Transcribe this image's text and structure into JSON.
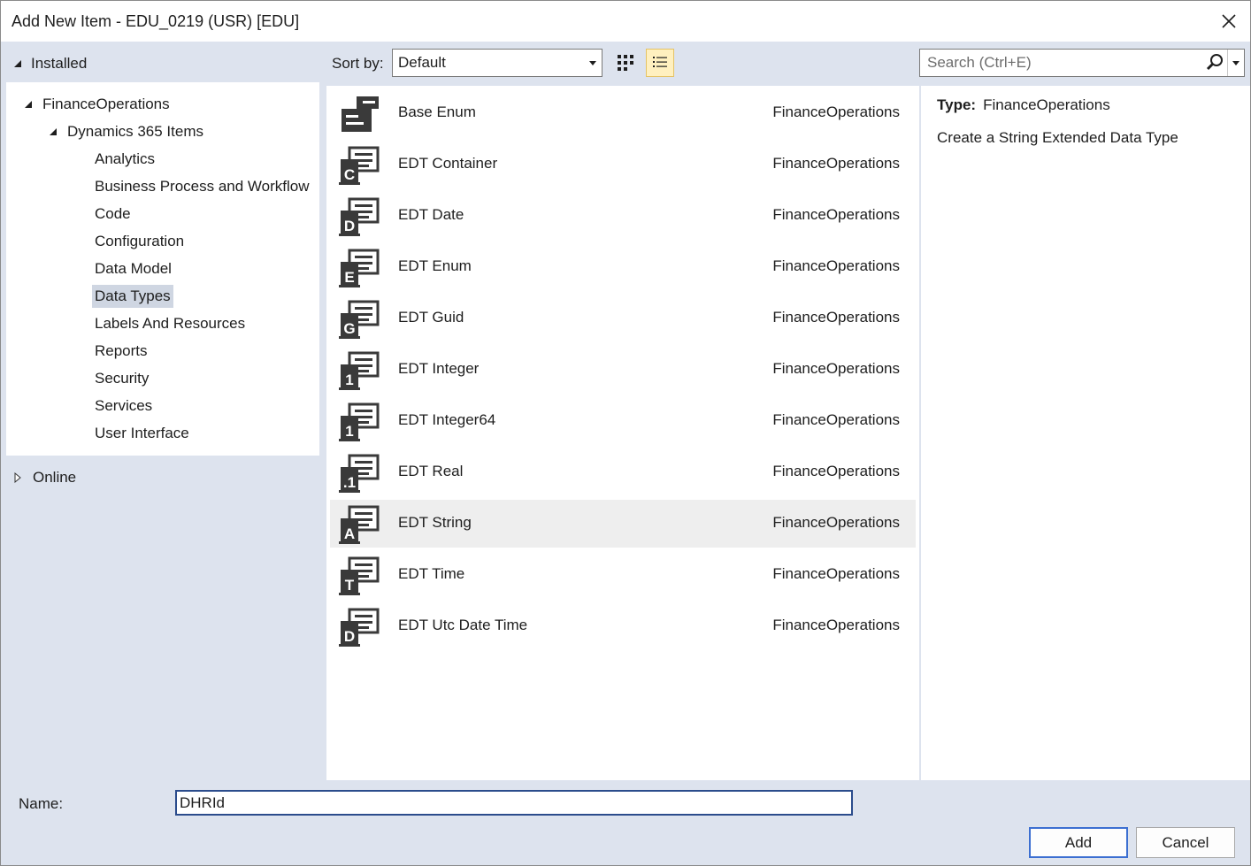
{
  "window": {
    "title": "Add New Item - EDU_0219 (USR) [EDU]"
  },
  "tree": {
    "installed_label": "Installed",
    "root_label": "FinanceOperations",
    "group_label": "Dynamics 365 Items",
    "items": [
      {
        "label": "Analytics"
      },
      {
        "label": "Business Process and Workflow"
      },
      {
        "label": "Code"
      },
      {
        "label": "Configuration"
      },
      {
        "label": "Data Model"
      },
      {
        "label": "Data Types",
        "selected": true
      },
      {
        "label": "Labels And Resources"
      },
      {
        "label": "Reports"
      },
      {
        "label": "Security"
      },
      {
        "label": "Services"
      },
      {
        "label": "User Interface"
      }
    ],
    "online_label": "Online"
  },
  "toolbar": {
    "sort_label": "Sort by:",
    "sort_value": "Default",
    "view_mode": "list"
  },
  "search": {
    "placeholder": "Search (Ctrl+E)",
    "value": ""
  },
  "items": [
    {
      "name": "Base Enum",
      "category": "FinanceOperations",
      "icon": "base-enum-icon",
      "letter": ""
    },
    {
      "name": "EDT Container",
      "category": "FinanceOperations",
      "icon": "edt-container-icon",
      "letter": "C"
    },
    {
      "name": "EDT Date",
      "category": "FinanceOperations",
      "icon": "edt-date-icon",
      "letter": "D"
    },
    {
      "name": "EDT Enum",
      "category": "FinanceOperations",
      "icon": "edt-enum-icon",
      "letter": "E"
    },
    {
      "name": "EDT Guid",
      "category": "FinanceOperations",
      "icon": "edt-guid-icon",
      "letter": "G"
    },
    {
      "name": "EDT Integer",
      "category": "FinanceOperations",
      "icon": "edt-integer-icon",
      "letter": "1"
    },
    {
      "name": "EDT Integer64",
      "category": "FinanceOperations",
      "icon": "edt-integer64-icon",
      "letter": "1"
    },
    {
      "name": "EDT Real",
      "category": "FinanceOperations",
      "icon": "edt-real-icon",
      "letter": ".1"
    },
    {
      "name": "EDT String",
      "category": "FinanceOperations",
      "icon": "edt-string-icon",
      "letter": "A",
      "selected": true
    },
    {
      "name": "EDT Time",
      "category": "FinanceOperations",
      "icon": "edt-time-icon",
      "letter": "T"
    },
    {
      "name": "EDT Utc Date Time",
      "category": "FinanceOperations",
      "icon": "edt-utc-date-time-icon",
      "letter": "D"
    }
  ],
  "info": {
    "type_label": "Type:",
    "type_value": "FinanceOperations",
    "description": "Create a String Extended Data Type"
  },
  "footer": {
    "name_label": "Name:",
    "name_value": "DHRId",
    "add_label": "Add",
    "cancel_label": "Cancel"
  }
}
